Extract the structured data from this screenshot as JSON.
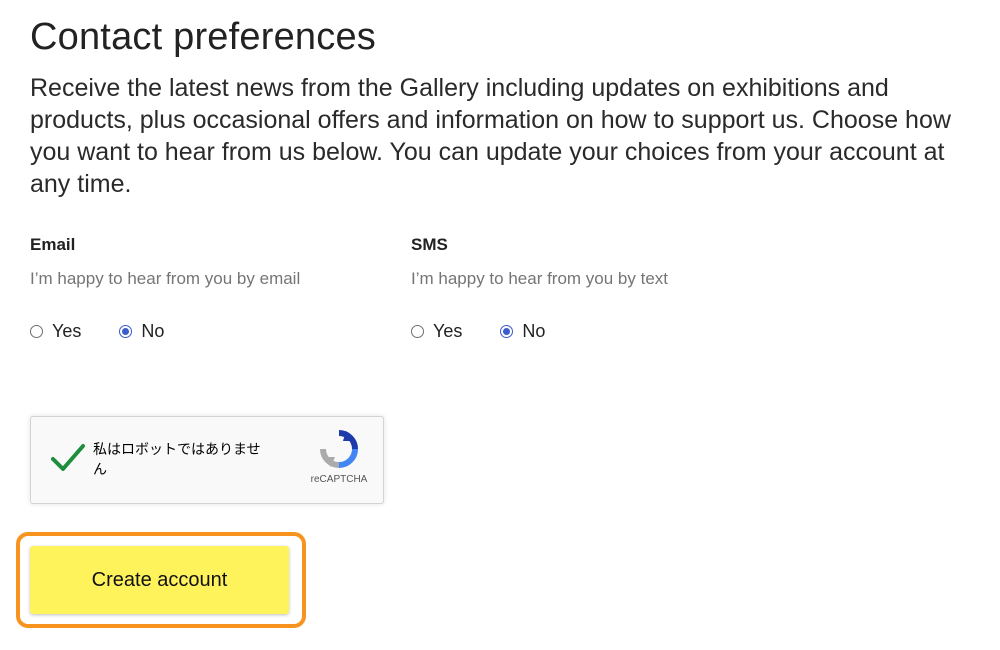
{
  "header": {
    "title": "Contact preferences",
    "intro": "Receive the latest news from the Gallery including updates on exhibitions and products, plus occasional offers and information on how to support us. Choose how you want to hear from us below. You can update your choices from your account at any time."
  },
  "preferences": {
    "email": {
      "heading": "Email",
      "description": "I’m happy to hear from you by email",
      "options": [
        {
          "label": "Yes",
          "selected": false
        },
        {
          "label": "No",
          "selected": true
        }
      ]
    },
    "sms": {
      "heading": "SMS",
      "description": "I’m happy to hear from you by text",
      "options": [
        {
          "label": "Yes",
          "selected": false
        },
        {
          "label": "No",
          "selected": true
        }
      ]
    }
  },
  "captcha": {
    "label": "私はロボットではありません",
    "brand": "reCAPTCHA",
    "checked": true,
    "check_color": "#1e8e3e"
  },
  "form": {
    "submit_label": "Create account",
    "submit_color": "#fff35c",
    "focus_color": "#f7931e"
  },
  "colors": {
    "radio_selected": "#3b5ccc"
  }
}
